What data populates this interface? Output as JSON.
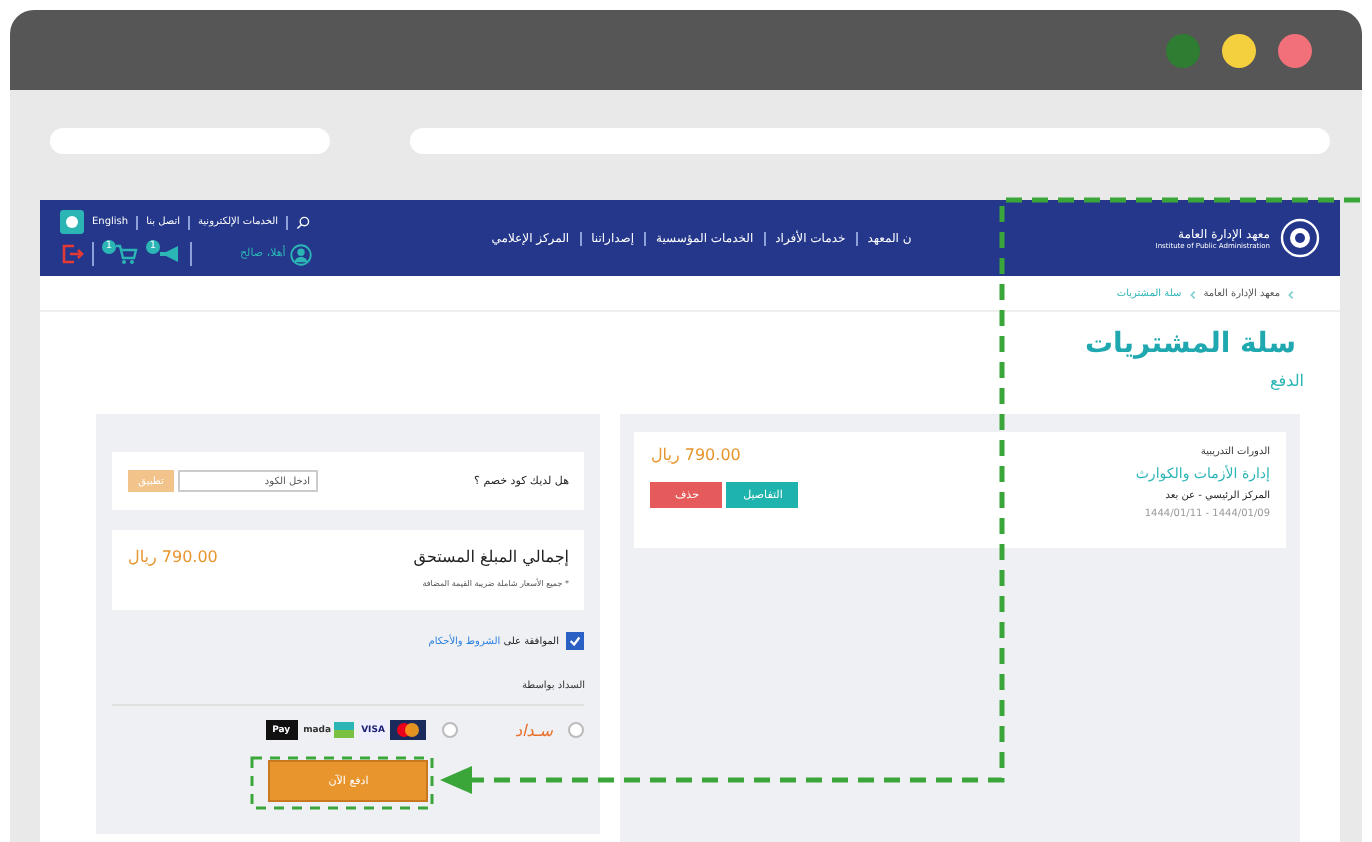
{
  "browser": {
    "dots": [
      {
        "color": "#2e7d32"
      },
      {
        "color": "#f4d03f"
      },
      {
        "color": "#f1707a"
      }
    ]
  },
  "header": {
    "logo": {
      "title": "معهد الإدارة العامة",
      "subtitle": "Institute of Public Administration"
    },
    "nav": [
      "ن المعهد",
      "خدمات الأفراد",
      "الخدمات المؤسسية",
      "إصداراتنا",
      "المركز الإعلامي"
    ],
    "top_links": [
      "الخدمات الإلكترونية",
      "اتصل بنا",
      "English"
    ],
    "user": "أهلا، صالح",
    "icons": [
      {
        "kind": "megaphone",
        "badge": "1"
      },
      {
        "kind": "cart",
        "badge": "1"
      },
      {
        "kind": "logout"
      }
    ]
  },
  "breadcrumb": [
    {
      "label": "معهد الإدارة العامة",
      "selected": false
    },
    {
      "label": "سلة المشتريات",
      "selected": true
    }
  ],
  "title": "سلة المشتريات",
  "subtitle": "الدفع",
  "cart_item": {
    "category": "الدورات التدريبية",
    "name": "إدارة الأزمات والكوارث",
    "location": "المركز الرئيسي - عن بعد",
    "dates": "1444/01/11 - 1444/01/09",
    "price": "790.00 ريال",
    "details_button": "التفاصيل",
    "delete_button": "حذف"
  },
  "discount": {
    "label": "هل لديك كود خصم ؟",
    "placeholder": "ادخل الكود",
    "button": "تطبيق",
    "disabled": true
  },
  "total": {
    "label": "إجمالي المبلغ المستحق",
    "amount": "790.00 ريال",
    "note": "* جميع الأسعار شاملة ضريبة القيمة المضافة"
  },
  "terms": {
    "checked": true,
    "text": "الموافقة على",
    "link": "الشروط والأحكام"
  },
  "payment": {
    "label": "السداد بواسطة",
    "methods": [
      {
        "kind": "sadad",
        "label": "سـداد",
        "selected": false
      },
      {
        "kind": "cards",
        "selected": false,
        "cards": [
          {
            "kind": "mastercard"
          },
          {
            "kind": "visa",
            "label": "VISA"
          },
          {
            "kind": "mada",
            "label": "mada"
          },
          {
            "kind": "applepay",
            "label": "Pay"
          }
        ]
      }
    ],
    "button": "ادفع الآن"
  }
}
